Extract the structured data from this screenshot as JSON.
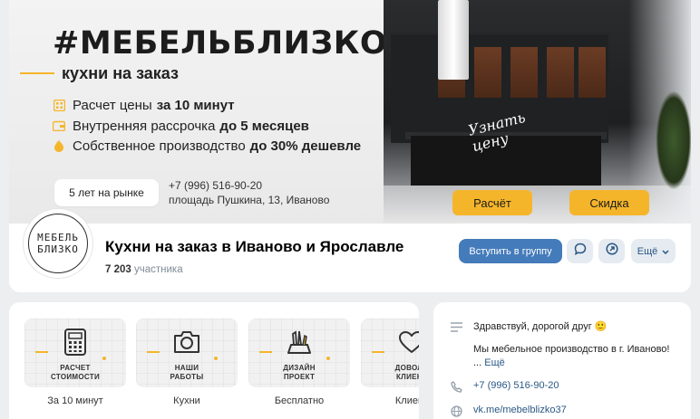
{
  "cover": {
    "hashtag": "#МЕБЕЛЬБЛИЗКО",
    "subtitle": "кухни на заказ",
    "features": [
      {
        "icon": "calculator-grid-icon",
        "text": "Расчет цены",
        "bold": "за 10 минут"
      },
      {
        "icon": "wallet-icon",
        "text": "Внутренняя рассрочка",
        "bold": "до 5 месяцев"
      },
      {
        "icon": "flame-icon",
        "text": "Собственное производство",
        "bold": "до 30% дешевле"
      }
    ],
    "years_badge": "5 лет на рынке",
    "phone": "+7 (996) 516-90-20",
    "address": "площадь Пушкина, 13, Иваново",
    "handwrite_line1": "Узнать",
    "handwrite_line2": "цену",
    "btn_calc": "Расчёт",
    "btn_discount": "Скидка",
    "accent_color": "#f5b52b"
  },
  "header": {
    "avatar_line1": "МЕБЕЛЬ",
    "avatar_line2": "БЛИЗКО",
    "group_name": "Кухни на заказ в Иваново и Ярославле",
    "members_count": "7 203",
    "members_label": "участника",
    "join_label": "Вступить в группу",
    "more_label": "Ещё",
    "join_color": "#447bba"
  },
  "services": [
    {
      "title_line1": "РАСЧЕТ",
      "title_line2": "СТОИМОСТИ",
      "caption": "За 10 минут",
      "icon": "calculator-icon"
    },
    {
      "title_line1": "НАШИ",
      "title_line2": "РАБОТЫ",
      "caption": "Кухни",
      "icon": "camera-icon"
    },
    {
      "title_line1": "ДИЗАЙН",
      "title_line2": "ПРОЕКТ",
      "caption": "Бесплатно",
      "icon": "design-tools-icon"
    },
    {
      "title_line1": "ДОВОЛЬ",
      "title_line2": "КЛИЕНТ",
      "caption": "Клиент",
      "icon": "heart-icon"
    }
  ],
  "info": {
    "greeting": "Здравствуй, дорогой друг 🙂",
    "description": "Мы мебельное производство в г. Иваново!",
    "ellipsis": "...",
    "more_link": "Ещё",
    "phone": "+7 (996) 516-90-20",
    "link": "vk.me/mebelblizko37"
  }
}
